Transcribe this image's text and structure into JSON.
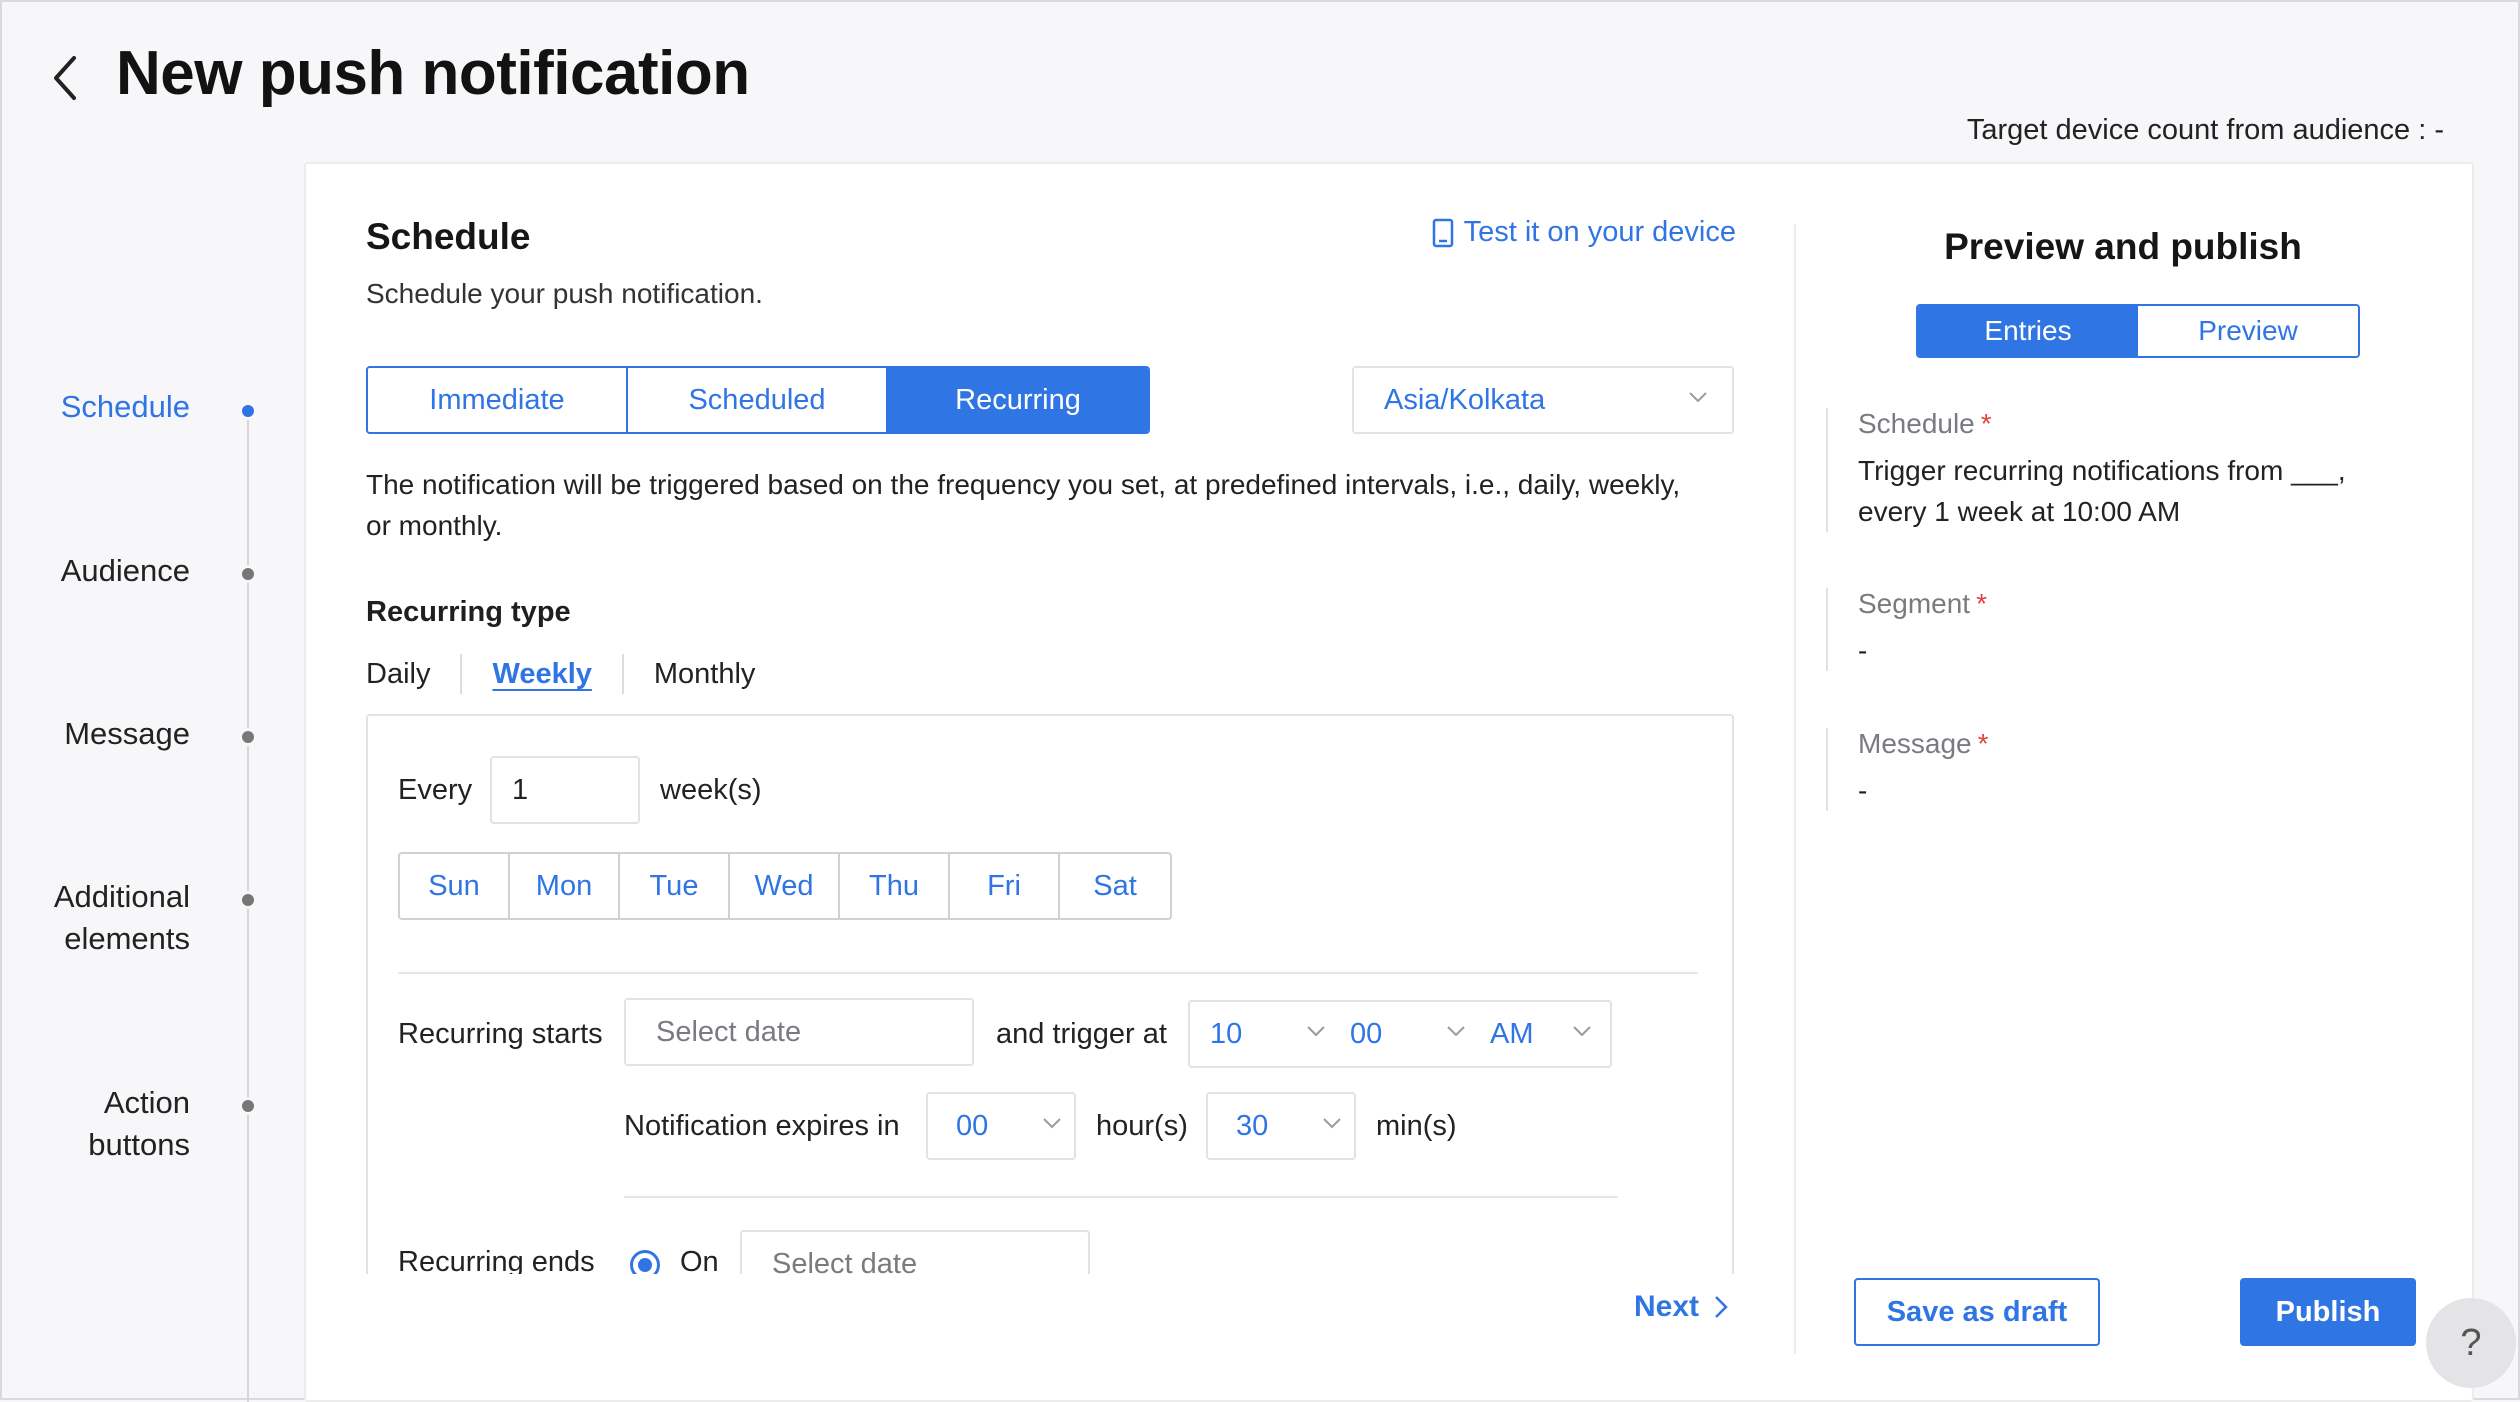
{
  "header": {
    "title": "New push notification",
    "target_count": "Target device count from audience : -"
  },
  "stepper": {
    "steps": [
      {
        "label": "Schedule",
        "active": true
      },
      {
        "label": "Audience",
        "active": false
      },
      {
        "label": "Message",
        "active": false
      },
      {
        "label": "Additional elements",
        "active": false
      },
      {
        "label": "Action buttons",
        "active": false
      }
    ]
  },
  "schedule": {
    "title": "Schedule",
    "subtitle": "Schedule your push notification.",
    "test_link": "Test it on your device",
    "modes": [
      "Immediate",
      "Scheduled",
      "Recurring"
    ],
    "selected_mode": "Recurring",
    "timezone": "Asia/Kolkata",
    "description": "The notification will be triggered based on the frequency you set, at predefined intervals, i.e., daily, weekly, or monthly.",
    "recurring_type_label": "Recurring type",
    "recurring_types": [
      "Daily",
      "Weekly",
      "Monthly"
    ],
    "selected_recurring_type": "Weekly",
    "every_label": "Every",
    "every_value": "1",
    "every_unit": "week(s)",
    "days": [
      "Sun",
      "Mon",
      "Tue",
      "Wed",
      "Thu",
      "Fri",
      "Sat"
    ],
    "recurring_starts_label": "Recurring starts",
    "start_date_placeholder": "Select date",
    "trigger_label": "and trigger at",
    "trigger_hour": "10",
    "trigger_minute": "00",
    "trigger_meridiem": "AM",
    "expires_label": "Notification expires in",
    "expires_hours": "00",
    "hours_unit": "hour(s)",
    "expires_minutes": "30",
    "minutes_unit": "min(s)",
    "ends_label": "Recurring ends",
    "ends_option": "On",
    "end_date_placeholder": "Select date",
    "next_label": "Next"
  },
  "preview": {
    "title": "Preview and publish",
    "tabs": [
      "Entries",
      "Preview"
    ],
    "active_tab": "Entries",
    "items": [
      {
        "label": "Schedule",
        "value": "Trigger recurring notifications from ___, every 1 week at 10:00 AM"
      },
      {
        "label": "Segment",
        "value": "-"
      },
      {
        "label": "Message",
        "value": "-"
      }
    ],
    "required_mark": "*",
    "save_draft_label": "Save as draft",
    "publish_label": "Publish"
  },
  "help": {
    "label": "?"
  },
  "colors": {
    "accent": "#3075e4",
    "required": "#e0443e"
  }
}
